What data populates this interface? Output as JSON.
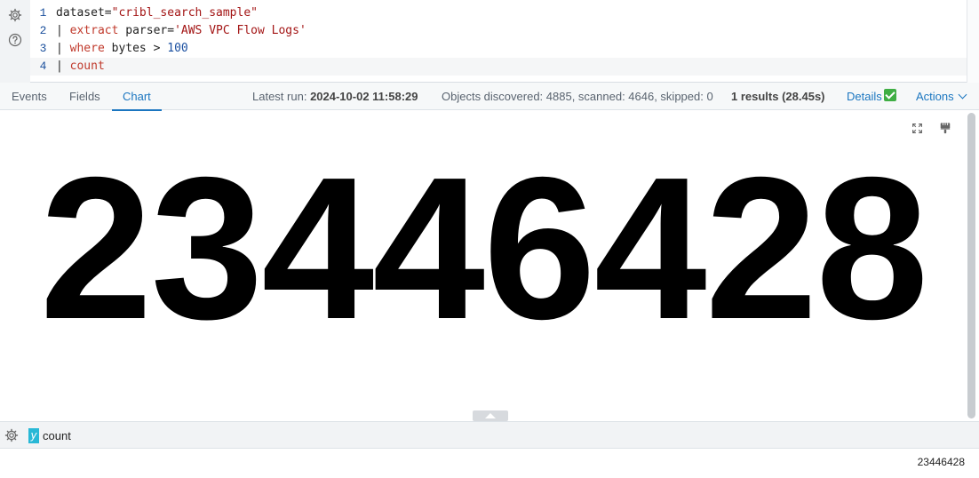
{
  "editor": {
    "lines": [
      {
        "num": "1",
        "tokens": [
          {
            "t": "dataset=",
            "c": "tk-ident"
          },
          {
            "t": "\"cribl_search_sample\"",
            "c": "tk-str"
          }
        ]
      },
      {
        "num": "2",
        "tokens": [
          {
            "t": "| ",
            "c": "tk-op"
          },
          {
            "t": "extract",
            "c": "tk-kw"
          },
          {
            "t": " parser=",
            "c": "tk-ident"
          },
          {
            "t": "'AWS VPC Flow Logs'",
            "c": "tk-str"
          }
        ]
      },
      {
        "num": "3",
        "tokens": [
          {
            "t": "| ",
            "c": "tk-op"
          },
          {
            "t": "where",
            "c": "tk-kw"
          },
          {
            "t": " bytes > ",
            "c": "tk-ident"
          },
          {
            "t": "100",
            "c": "tk-num"
          }
        ]
      },
      {
        "num": "4",
        "tokens": [
          {
            "t": "| ",
            "c": "tk-op"
          },
          {
            "t": "count",
            "c": "tk-kw"
          }
        ]
      }
    ]
  },
  "tabs": {
    "events": "Events",
    "fields": "Fields",
    "chart": "Chart"
  },
  "status": {
    "latest_run_label": "Latest run:",
    "latest_run_value": "2024-10-02 11:58:29",
    "objects": "Objects discovered: 4885, scanned: 4646, skipped: 0",
    "results": "1 results (28.45s)",
    "details": "Details",
    "actions": "Actions"
  },
  "chart": {
    "big_value": "23446428"
  },
  "legend": {
    "axis_badge": "y",
    "series_label": "count"
  },
  "table": {
    "value": "23446428"
  },
  "colors": {
    "accent": "#1b76c0",
    "success": "#3fae44",
    "y_badge": "#28b8d6"
  }
}
